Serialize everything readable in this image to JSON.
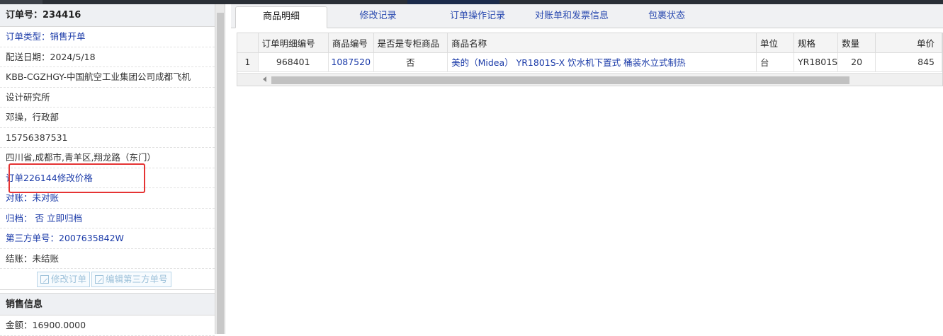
{
  "left_panel": {
    "order_no_label": "订单号：",
    "order_no": "234416",
    "rows": [
      {
        "text": "订单类型：销售开单",
        "style": "blue"
      },
      {
        "text": "配送日期：2024/5/18",
        "style": "plain"
      },
      {
        "text": "KBB-CGZHGY-中国航空工业集团公司成都飞机",
        "style": "plain"
      },
      {
        "text": "设计研究所",
        "style": "plain"
      },
      {
        "text": "邓操，行政部",
        "style": "plain"
      },
      {
        "text": "15756387531",
        "style": "plain"
      },
      {
        "text": "四川省,成都市,青羊区,翔龙路（东门）",
        "style": "plain"
      },
      {
        "text": "订单226144修改价格",
        "style": "blue"
      },
      {
        "text": "对账：未对账",
        "style": "blue"
      },
      {
        "text": "归档： 否 立即归档",
        "style": "blue"
      },
      {
        "text": "第三方单号：2007635842W",
        "style": "blue"
      },
      {
        "text": "结账：未结账",
        "style": "plain"
      }
    ],
    "buttons": {
      "edit_order": "修改订单",
      "edit_third_party": "编辑第三方单号"
    },
    "sales_section_title": "销售信息",
    "amount": "金额：16900.0000"
  },
  "tabs": [
    {
      "label": "商品明细",
      "active": true
    },
    {
      "label": "修改记录",
      "active": false
    },
    {
      "label": "订单操作记录",
      "active": false
    },
    {
      "label": "对账单和发票信息",
      "active": false
    },
    {
      "label": "包裹状态",
      "active": false
    }
  ],
  "table": {
    "headers": [
      "",
      "订单明细编号",
      "商品编号",
      "是否是专柜商品",
      "商品名称",
      "单位",
      "规格",
      "数量",
      "单价"
    ],
    "rows": [
      [
        "1",
        "968401",
        "1087520",
        "否",
        "美的（Midea） YR1801S-X 饮水机下置式 桶装水立式制热",
        "台",
        "YR1801S",
        "20",
        "845"
      ]
    ]
  },
  "colors": {
    "link": "#1a3aa8",
    "highlight_box": "#e53333",
    "header_bg": "#eef0f3"
  }
}
